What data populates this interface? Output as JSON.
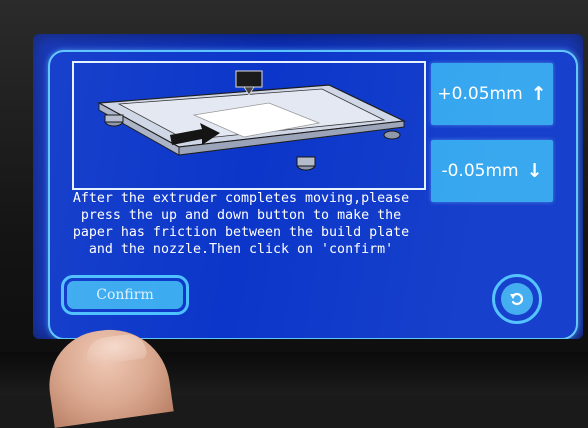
{
  "screen": {
    "adjust_up": {
      "label": "+0.05mm",
      "icon": "arrow-up-icon",
      "glyph": "↑"
    },
    "adjust_down": {
      "label": "-0.05mm",
      "icon": "arrow-down-icon",
      "glyph": "↓"
    },
    "instruction": "After the extruder completes moving,please\npress the up and down button to make the\npaper has friction between the build plate\nand the nozzle.Then click on 'confirm'",
    "confirm_label": "Confirm",
    "back_icon": "back-arrow-icon"
  },
  "colors": {
    "screen_bg": "#0b36c9",
    "button_fill": "#2ea3ee",
    "outline": "#5cc4ff",
    "text": "#ffffff"
  }
}
